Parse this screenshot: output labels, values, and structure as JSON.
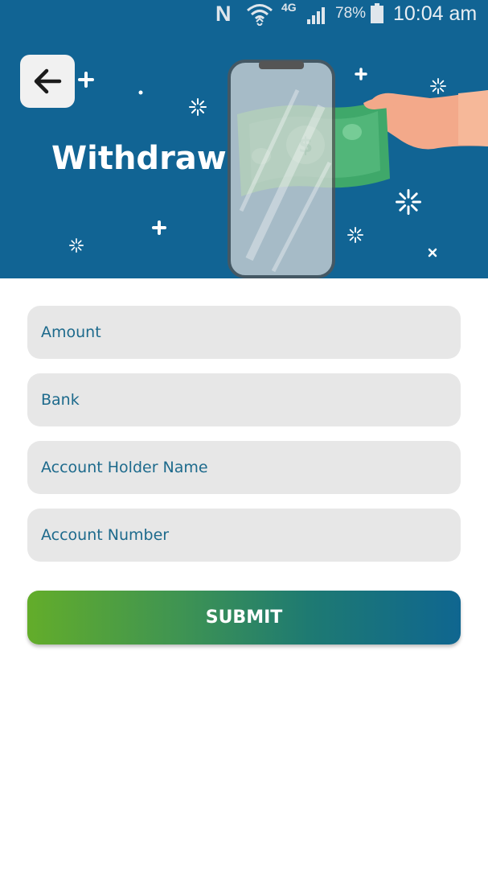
{
  "status_bar": {
    "network_type": "4G",
    "battery_percent": "78%",
    "time": "10:04 am",
    "icons": [
      "nfc-icon",
      "wifi-icon",
      "signal-icon",
      "battery-icon"
    ]
  },
  "header": {
    "title": "Withdraw",
    "background_color": "#116494",
    "back_icon": "arrow-left-icon"
  },
  "form": {
    "amount_placeholder": "Amount",
    "bank_placeholder": "Bank",
    "holder_name_placeholder": "Account Holder Name",
    "account_number_placeholder": "Account Number",
    "submit_label": "SUBMIT",
    "field_background": "#e7e7e7",
    "submit_gradient": [
      "#63ad2a",
      "#0f6690"
    ]
  }
}
